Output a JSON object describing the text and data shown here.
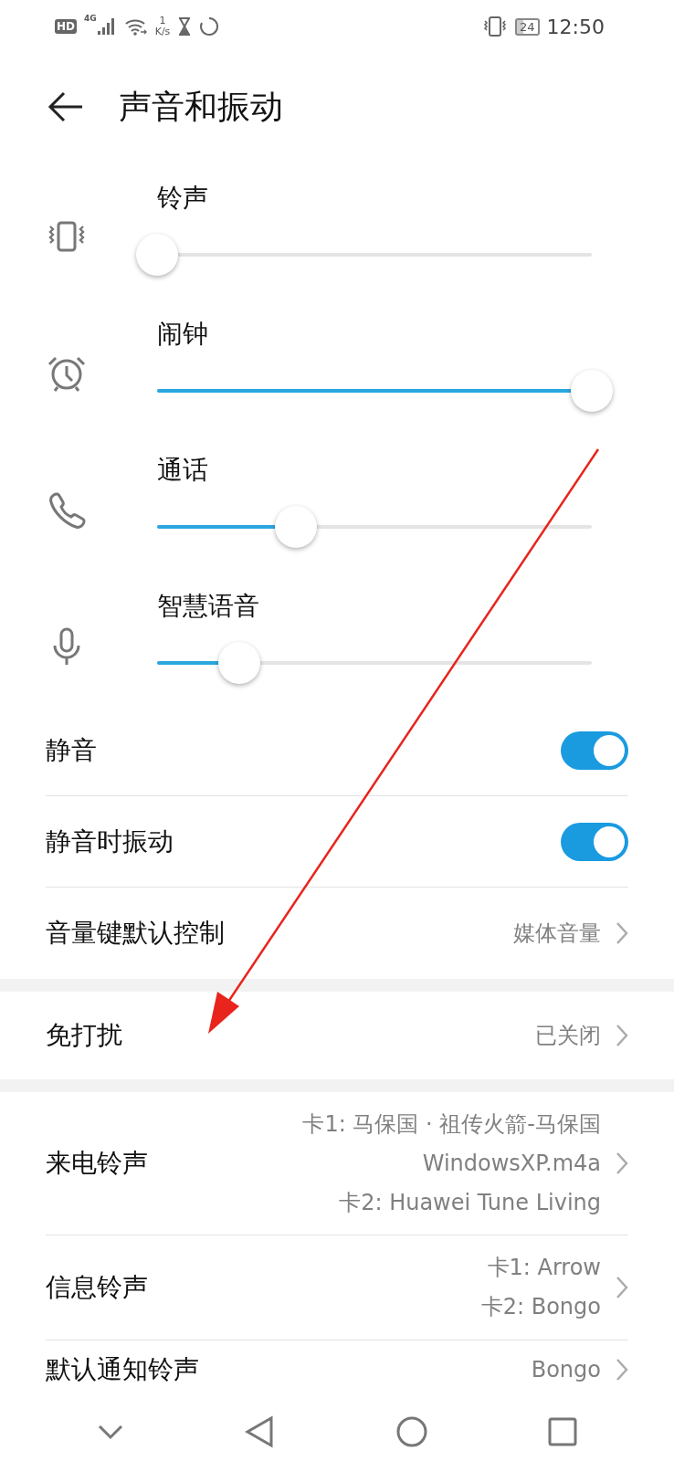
{
  "status_bar": {
    "network": "4G",
    "hd": "HD",
    "speed_value": "1",
    "speed_unit": "K/s",
    "battery": "24",
    "time": "12:50"
  },
  "header": {
    "title": "声音和振动"
  },
  "volumes": [
    {
      "kind": "ring",
      "label": "铃声",
      "level": 0
    },
    {
      "kind": "alarm",
      "label": "闹钟",
      "level": 1
    },
    {
      "kind": "call",
      "label": "通话",
      "level": 0.32
    },
    {
      "kind": "voice",
      "label": "智慧语音",
      "level": 0.19
    }
  ],
  "groups": [
    [
      {
        "kind": "toggle",
        "label": "静音",
        "on": true
      },
      {
        "kind": "toggle",
        "label": "静音时振动",
        "on": true
      },
      {
        "kind": "link",
        "label": "音量键默认控制",
        "values": [
          "媒体音量"
        ]
      }
    ],
    [
      {
        "kind": "link",
        "label": "免打扰",
        "values": [
          "已关闭"
        ]
      }
    ],
    [
      {
        "kind": "link",
        "label": "来电铃声",
        "values": [
          "卡1: 马保国 · 祖传火箭-马保国",
          "WindowsXP.m4a",
          "卡2: Huawei Tune Living"
        ]
      },
      {
        "kind": "link",
        "label": "信息铃声",
        "values": [
          "卡1: Arrow",
          "卡2: Bongo"
        ]
      },
      {
        "kind": "link",
        "label": "默认通知铃声",
        "values": [
          "Bongo"
        ]
      }
    ]
  ]
}
